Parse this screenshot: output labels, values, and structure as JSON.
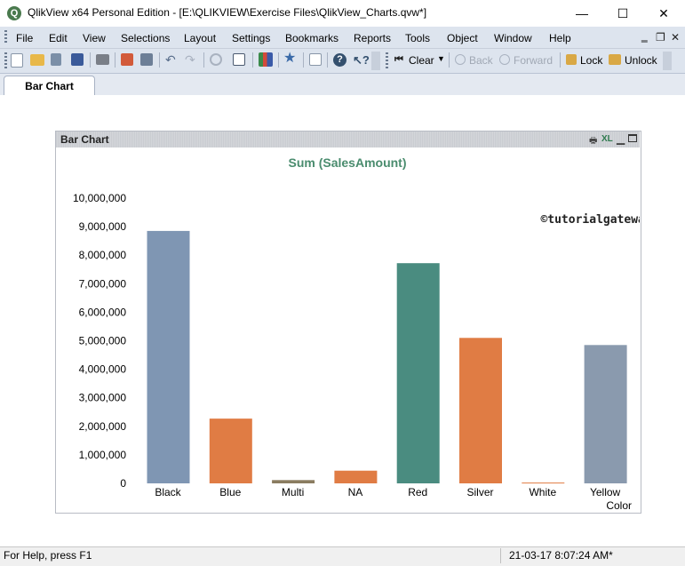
{
  "window": {
    "title": "QlikView x64 Personal Edition - [E:\\QLIKVIEW\\Exercise Files\\QlikView_Charts.qvw*]",
    "logo_letter": "Q",
    "minimize": "—",
    "maximize": "☐",
    "close": "✕"
  },
  "menu": {
    "items": [
      "File",
      "Edit",
      "View",
      "Selections",
      "Layout",
      "Settings",
      "Bookmarks",
      "Reports",
      "Tools",
      "Object",
      "Window",
      "Help"
    ],
    "mdi_minimize": "‗",
    "mdi_restore": "❐",
    "mdi_close": "✕"
  },
  "toolbar": {
    "clear_label": "Clear",
    "back_label": "Back",
    "forward_label": "Forward",
    "lock_label": "Lock",
    "unlock_label": "Unlock"
  },
  "tabs": [
    {
      "label": "Bar Chart"
    }
  ],
  "chart_object": {
    "caption": "Bar Chart",
    "xl_icon": "XL",
    "watermark": "©tutorialgateway.org"
  },
  "chart_data": {
    "type": "bar",
    "title": "Sum (SalesAmount)",
    "xlabel": "Color",
    "ylabel": "",
    "categories": [
      "Black",
      "Blue",
      "Multi",
      "NA",
      "Red",
      "Silver",
      "White",
      "Yellow"
    ],
    "values": [
      8850000,
      2270000,
      115000,
      445000,
      7720000,
      5100000,
      28000,
      4850000
    ],
    "ylim": [
      0,
      10000000
    ],
    "yticks": [
      "0",
      "1,000,000",
      "2,000,000",
      "3,000,000",
      "4,000,000",
      "5,000,000",
      "6,000,000",
      "7,000,000",
      "8,000,000",
      "9,000,000",
      "10,000,000"
    ],
    "bar_colors": [
      "#7f96b3",
      "#e07c44",
      "#8a7c60",
      "#e07c44",
      "#4a8c80",
      "#e07c44",
      "#e07c44",
      "#8a9aae"
    ],
    "title_color": "#4a8c6e",
    "grid": false
  },
  "status": {
    "left": "For Help, press F1",
    "right": "21-03-17 8:07:24 AM*"
  }
}
